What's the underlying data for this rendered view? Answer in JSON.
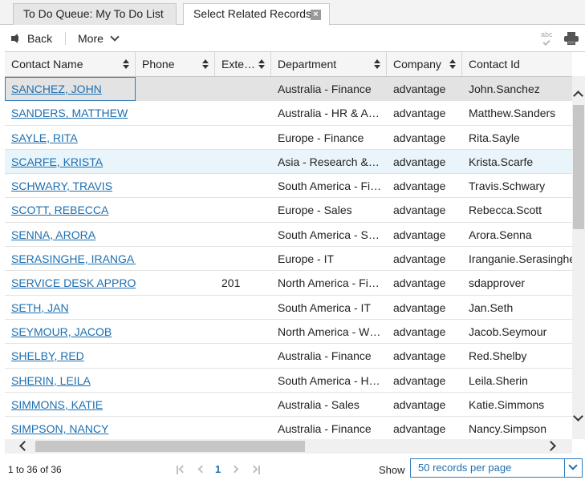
{
  "tabs": [
    {
      "label": "To Do Queue: My To Do List",
      "active": false
    },
    {
      "label": "Select Related Records",
      "active": true,
      "close": "×"
    }
  ],
  "toolbar": {
    "back_label": "Back",
    "more_label": "More",
    "spell_label": "abc"
  },
  "columns": [
    {
      "label": "Contact Name",
      "sortable": true
    },
    {
      "label": "Phone",
      "sortable": true
    },
    {
      "label": "Exte…",
      "sortable": true
    },
    {
      "label": "Department",
      "sortable": true
    },
    {
      "label": "Company",
      "sortable": true
    },
    {
      "label": "Contact Id",
      "sortable": false
    }
  ],
  "rows": [
    {
      "name": "SANCHEZ, JOHN",
      "phone": "",
      "ext": "",
      "department": "Australia - Finance",
      "company": "advantage",
      "contact_id": "John.Sanchez",
      "state": "selected"
    },
    {
      "name": "SANDERS, MATTHEW",
      "phone": "",
      "ext": "",
      "department": "Australia - HR & A…",
      "company": "advantage",
      "contact_id": "Matthew.Sanders",
      "state": ""
    },
    {
      "name": "SAYLE, RITA",
      "phone": "",
      "ext": "",
      "department": "Europe - Finance",
      "company": "advantage",
      "contact_id": "Rita.Sayle",
      "state": ""
    },
    {
      "name": "SCARFE, KRISTA",
      "phone": "",
      "ext": "",
      "department": "Asia - Research &…",
      "company": "advantage",
      "contact_id": "Krista.Scarfe",
      "state": "hover"
    },
    {
      "name": "SCHWARY, TRAVIS",
      "phone": "",
      "ext": "",
      "department": "South America - Fi…",
      "company": "advantage",
      "contact_id": "Travis.Schwary",
      "state": ""
    },
    {
      "name": "SCOTT, REBECCA",
      "phone": "",
      "ext": "",
      "department": "Europe - Sales",
      "company": "advantage",
      "contact_id": "Rebecca.Scott",
      "state": ""
    },
    {
      "name": "SENNA, ARORA",
      "phone": "",
      "ext": "",
      "department": "South America - S…",
      "company": "advantage",
      "contact_id": "Arora.Senna",
      "state": ""
    },
    {
      "name": "SERASINGHE, IRANGA…",
      "phone": "",
      "ext": "",
      "department": "Europe - IT",
      "company": "advantage",
      "contact_id": "Iranganie.Serasinghe",
      "state": ""
    },
    {
      "name": "SERVICE DESK APPRO…",
      "phone": "",
      "ext": "201",
      "department": "North America - Fi…",
      "company": "advantage",
      "contact_id": "sdapprover",
      "state": ""
    },
    {
      "name": "SETH, JAN",
      "phone": "",
      "ext": "",
      "department": "South America - IT",
      "company": "advantage",
      "contact_id": "Jan.Seth",
      "state": ""
    },
    {
      "name": "SEYMOUR, JACOB",
      "phone": "",
      "ext": "",
      "department": "North America - W…",
      "company": "advantage",
      "contact_id": "Jacob.Seymour",
      "state": ""
    },
    {
      "name": "SHELBY, RED",
      "phone": "",
      "ext": "",
      "department": "Australia - Finance",
      "company": "advantage",
      "contact_id": "Red.Shelby",
      "state": ""
    },
    {
      "name": "SHERIN, LEILA",
      "phone": "",
      "ext": "",
      "department": "South America - H…",
      "company": "advantage",
      "contact_id": "Leila.Sherin",
      "state": ""
    },
    {
      "name": "SIMMONS, KATIE",
      "phone": "",
      "ext": "",
      "department": "Australia - Sales",
      "company": "advantage",
      "contact_id": "Katie.Simmons",
      "state": ""
    },
    {
      "name": "SIMPSON, NANCY",
      "phone": "",
      "ext": "",
      "department": "Australia - Finance",
      "company": "advantage",
      "contact_id": "Nancy.Simpson",
      "state": ""
    }
  ],
  "footer": {
    "count": "1 to 36 of 36",
    "current_page": "1",
    "show_label": "Show",
    "page_size": "50 records per page"
  },
  "colors": {
    "link": "#1c6fb1",
    "selected_row": "#e3e3e3",
    "hover_row": "#e9f5fb",
    "focus_border": "#2f7bbd"
  }
}
